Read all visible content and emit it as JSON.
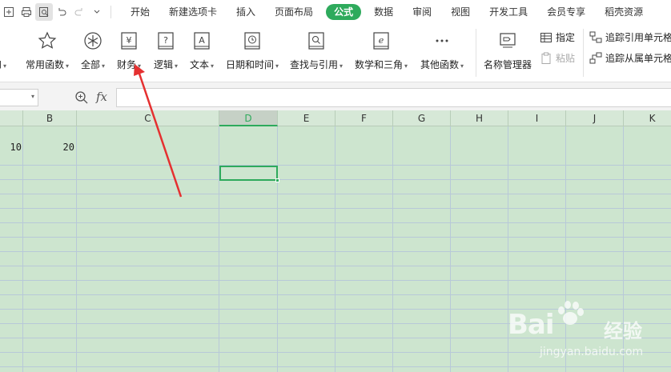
{
  "menubar": {
    "tabs": [
      "开始",
      "新建选项卡",
      "插入",
      "页面布局",
      "公式",
      "数据",
      "审阅",
      "视图",
      "开发工具",
      "会员专享",
      "稻壳资源"
    ],
    "active_tab": "公式"
  },
  "ribbon": {
    "partial_left": "和",
    "buttons": [
      {
        "label": "常用函数",
        "icon": "star-icon"
      },
      {
        "label": "全部",
        "icon": "asterisk-circle-icon"
      },
      {
        "label": "财务",
        "icon": "yen-book-icon"
      },
      {
        "label": "逻辑",
        "icon": "question-book-icon"
      },
      {
        "label": "文本",
        "icon": "text-book-icon"
      },
      {
        "label": "日期和时间",
        "icon": "clock-book-icon"
      },
      {
        "label": "查找与引用",
        "icon": "search-book-icon"
      },
      {
        "label": "数学和三角",
        "icon": "math-book-icon"
      },
      {
        "label": "其他函数",
        "icon": "more-dots-icon"
      }
    ],
    "name_manager": "名称管理器",
    "specify": "指定",
    "paste": "粘贴",
    "trace_precedents": "追踪引用单元格",
    "trace_dependents": "追踪从属单元格"
  },
  "formula_bar": {
    "fx": "fx",
    "value": ""
  },
  "columns": [
    "B",
    "C",
    "D",
    "E",
    "F",
    "G",
    "H",
    "I",
    "J",
    "K"
  ],
  "selected_column": "D",
  "cells": {
    "A1": "10",
    "B1": "20"
  },
  "watermark": {
    "brand": "Bai",
    "brand_suffix": "经验",
    "url": "jingyan.baidu.com"
  },
  "colors": {
    "accent": "#2eaa5c",
    "sheet_bg": "#cde5cf",
    "arrow": "#e53030"
  }
}
